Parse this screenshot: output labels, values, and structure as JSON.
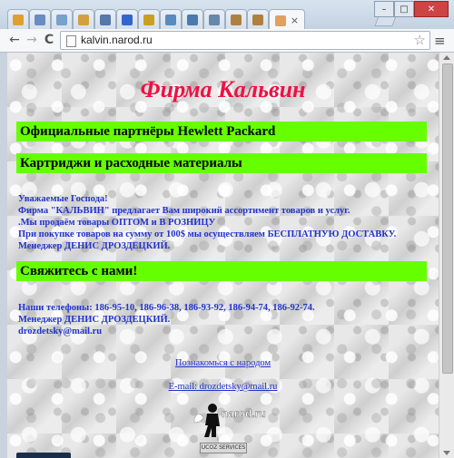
{
  "browser": {
    "tabs": [
      {
        "favicon_color": "#e0a030"
      },
      {
        "favicon_color": "#6a8cc0"
      },
      {
        "favicon_color": "#7aa0cc"
      },
      {
        "favicon_color": "#d2a040"
      },
      {
        "favicon_color": "#5577aa"
      },
      {
        "favicon_color": "#3366cc"
      },
      {
        "favicon_color": "#caa020"
      },
      {
        "favicon_color": "#5b8abf"
      },
      {
        "favicon_color": "#4a7ab0"
      },
      {
        "favicon_color": "#6688aa"
      },
      {
        "favicon_color": "#b08040"
      },
      {
        "favicon_color": "#b08040"
      },
      {
        "favicon_color": "#e0a060"
      }
    ],
    "active_tab_close": "×",
    "window_min": "–",
    "window_max": "□",
    "window_close": "✕",
    "nav_back": "←",
    "nav_forward": "→",
    "nav_reload": "C",
    "url": "kalvin.narod.ru",
    "star": "☆",
    "menu": "≡"
  },
  "page": {
    "title": "Фирма Кальвин",
    "band1": "Официальные партнёры Hewlett Packard",
    "band2": "Картриджи и расходные материалы",
    "intro_lines": [
      "Уважаемые Господа!",
      "Фирма \"КАЛЬВИН\" предлагает Вам широкий ассортимент товаров и услуг.",
      ".Мы продаём товары ОПТОМ и В РОЗНИЦУ",
      "При покупке товаров на сумму от 100$ мы осуществляем БЕСПЛАТНУЮ ДОСТАВКУ.",
      "Менеджер ДЕНИС ДРОЗДЕЦКИЙ."
    ],
    "band3": "Свяжитесь с нами!",
    "contact_lines": [
      "Наши телефоны: 186-95-10, 186-96-38, 186-93-92, 186-94-74, 186-92-74.",
      "Менеджер ДЕНИС ДРОЗДЕЦКИЙ.",
      "drozdetsky@mail.ru"
    ],
    "link_narod": "Познакомься с народом",
    "link_email": "E-mail: drozdetsky@mail.ru",
    "logo_text": "narod.ru",
    "badge_text": "UCOZ SERVICES",
    "colors": {
      "title": "#ee1144",
      "band": "#66ff00",
      "text": "#2233cc"
    }
  }
}
